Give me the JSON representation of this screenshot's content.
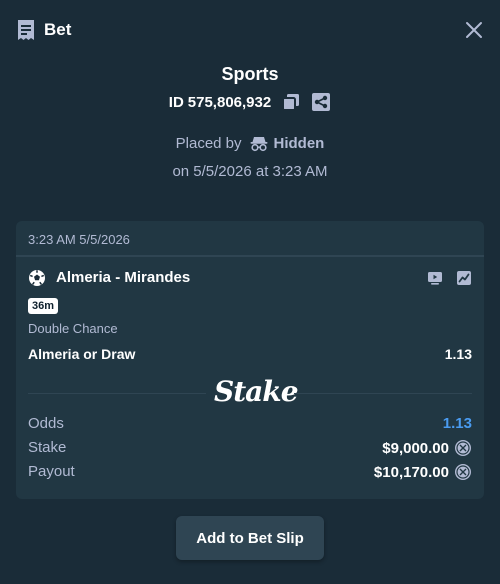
{
  "header": {
    "title": "Bet"
  },
  "summary": {
    "sport": "Sports",
    "id_label": "ID",
    "id_value": "575,806,932",
    "placed_by_label": "Placed by",
    "placed_by_user": "Hidden",
    "placed_on": "on 5/5/2026 at 3:23 AM"
  },
  "card": {
    "timestamp": "3:23 AM 5/5/2026",
    "match": "Almeria - Mirandes",
    "live_time": "36m",
    "market": "Double Chance",
    "selection": "Almeria or Draw",
    "selection_odds": "1.13",
    "brand": "Stake",
    "rows": [
      {
        "label": "Odds",
        "value": "1.13"
      },
      {
        "label": "Stake",
        "value": "$9,000.00"
      },
      {
        "label": "Payout",
        "value": "$10,170.00"
      }
    ]
  },
  "actions": {
    "add_to_slip": "Add to Bet Slip"
  },
  "colors": {
    "background": "#1a2c38",
    "card": "#213743",
    "accent_odds": "#4a9bf0",
    "muted_text": "#b1bad3"
  }
}
